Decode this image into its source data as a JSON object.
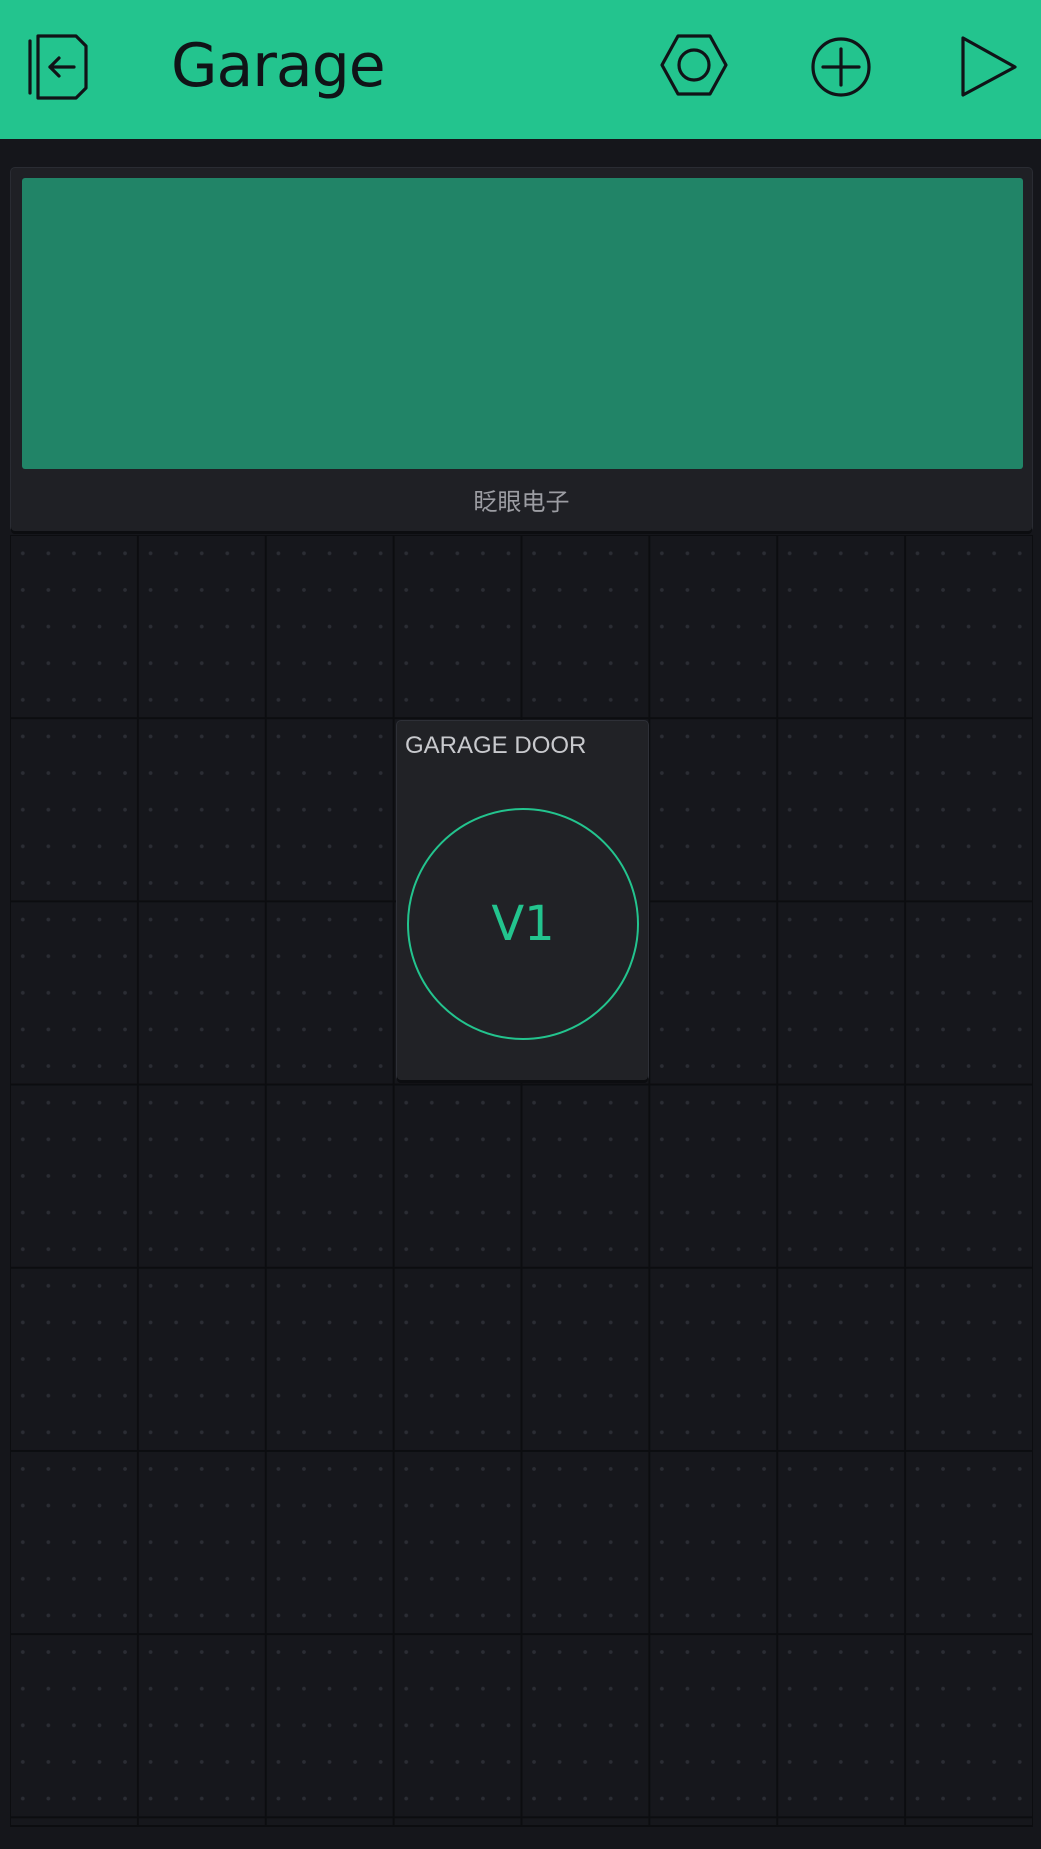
{
  "header": {
    "title": "Garage",
    "icons": {
      "back": "exit-to-left-icon",
      "settings": "hexagon-nut-icon",
      "add": "plus-circle-icon",
      "play": "play-triangle-icon"
    }
  },
  "lcd_widget": {
    "label": "眨眼电子"
  },
  "button_widget": {
    "label": "GARAGE DOOR",
    "pin": "V1"
  },
  "colors": {
    "accent": "#23c48e",
    "background": "#15161b",
    "lcd_screen": "#218467",
    "widget": "#212226"
  }
}
